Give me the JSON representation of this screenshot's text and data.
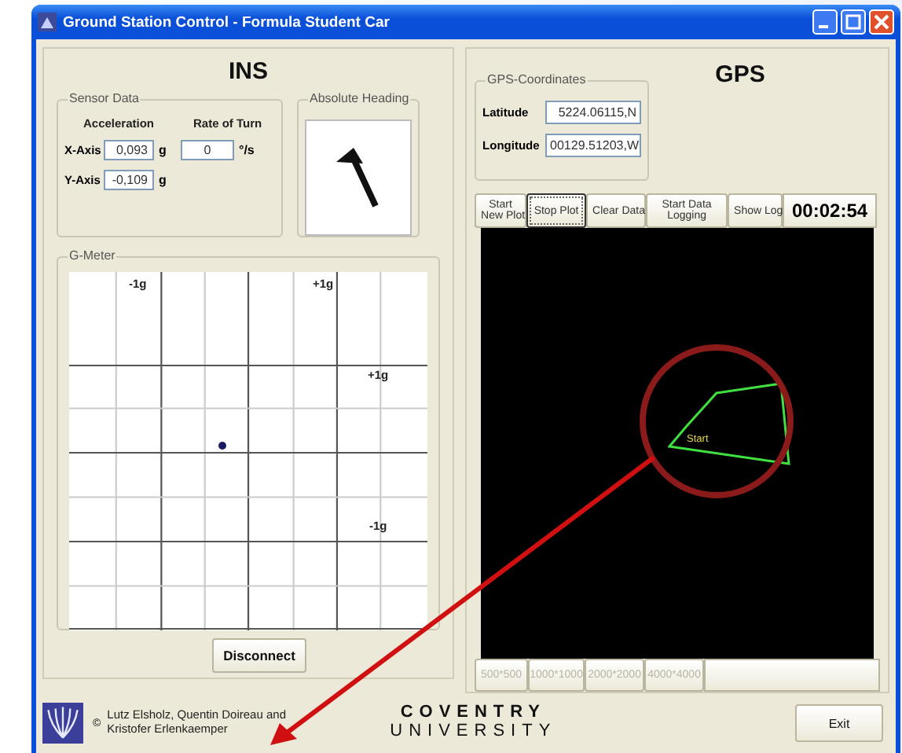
{
  "window": {
    "title": "Ground Station Control - Formula Student Car"
  },
  "ins": {
    "title": "INS",
    "sensor_data": {
      "legend": "Sensor Data",
      "headers": [
        "Acceleration",
        "Rate of Turn"
      ],
      "rows": [
        {
          "label": "X-Axis",
          "acceleration": "0,093",
          "acceleration_unit": "g",
          "rate": "0",
          "rate_unit": "°/s"
        },
        {
          "label": "Y-Axis",
          "acceleration": "-0,109",
          "acceleration_unit": "g"
        }
      ]
    },
    "absolute_heading": {
      "legend": "Absolute Heading"
    },
    "g_meter": {
      "legend": "G-Meter",
      "labels": [
        "-1g",
        "+1g",
        "+1g",
        "-1g"
      ]
    },
    "disconnect_button": "Disconnect"
  },
  "gps": {
    "title": "GPS",
    "coordinates": {
      "legend": "GPS-Coordinates",
      "fields": [
        {
          "label": "Latitude",
          "value": "5224.06115,N"
        },
        {
          "label": "Longitude",
          "value": "00129.51203,W"
        }
      ]
    },
    "toolbar": [
      {
        "label": "Start\nNew Plot",
        "focused": false
      },
      {
        "label": "Stop Plot",
        "focused": true
      },
      {
        "label": "Clear Data",
        "focused": false
      },
      {
        "label": "Start Data\nLogging",
        "focused": false
      },
      {
        "label": "Show Log",
        "focused": false
      }
    ],
    "timer": "00:02:54",
    "plot": {
      "start_label": "Start"
    },
    "scale_buttons": [
      {
        "label": "500*500",
        "disabled": true
      },
      {
        "label": "1000*1000",
        "disabled": true
      },
      {
        "label": "2000*2000",
        "disabled": true
      },
      {
        "label": "4000*4000",
        "disabled": true
      }
    ]
  },
  "footer": {
    "copyright": "©",
    "credits": "Lutz Elsholz, Quentin Doireau and\nKristofer Erlenkaemper",
    "logo_lines": [
      "COVENTRY",
      "UNIVERSITY"
    ],
    "exit_button": "Exit"
  }
}
